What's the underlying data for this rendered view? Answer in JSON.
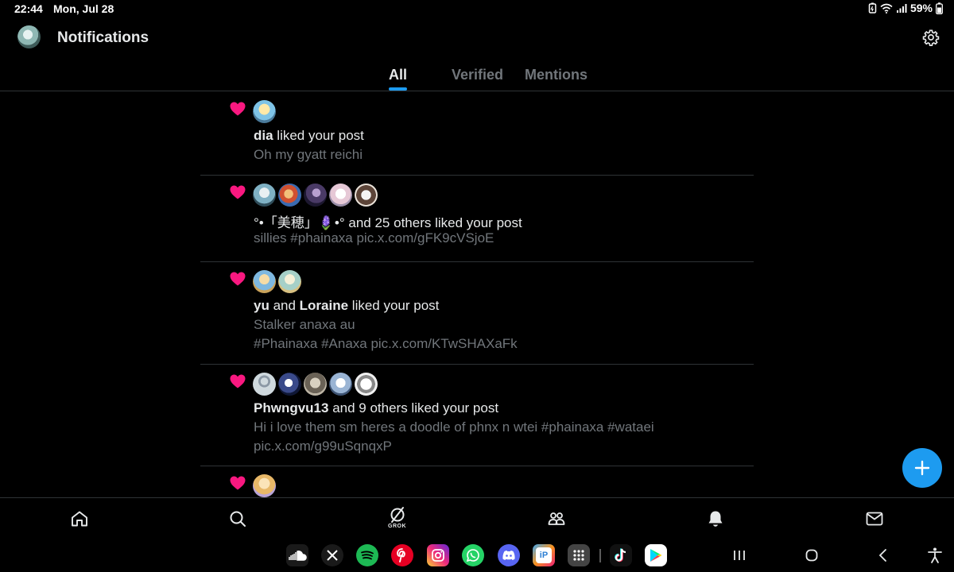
{
  "status_bar": {
    "time": "22:44",
    "date": "Mon, Jul 28",
    "battery": "59%",
    "icons": [
      "battery-saver-icon",
      "wifi-icon",
      "signal-icon",
      "battery-icon"
    ]
  },
  "header": {
    "title": "Notifications",
    "settings_icon": "gear-icon"
  },
  "tabs": [
    {
      "label": "All",
      "active": true
    },
    {
      "label": "Verified",
      "active": false
    },
    {
      "label": "Mentions",
      "active": false
    }
  ],
  "colors": {
    "accent": "#1d9bf0",
    "like": "#f91880",
    "muted_text": "#71767b",
    "primary_text": "#e7e9ea",
    "divider": "#2f3336"
  },
  "notifications": [
    {
      "type": "like",
      "actor_bold": "dia",
      "action": " liked your post",
      "preview_lines": [
        "Oh my gyatt reichi"
      ]
    },
    {
      "type": "like",
      "actor_text": "°•「美穂」🪻•°",
      "action": " and 25 others liked your post",
      "preview_lines": [
        "sillies #phainaxa pic.x.com/gFK9cVSjoE"
      ]
    },
    {
      "type": "like",
      "actor_bold": "yu",
      "connector": " and ",
      "actor2_bold": "Loraine",
      "action": " liked your post",
      "preview_lines": [
        "Stalker anaxa au",
        "#Phainaxa #Anaxa pic.x.com/KTwSHAXaFk"
      ]
    },
    {
      "type": "like",
      "actor_bold": "Phwngvu13",
      "action": " and 9 others liked your post",
      "preview_lines": [
        "Hi i love them sm heres a doodle of phnx n wtei #phainaxa #wataei",
        "pic.x.com/g99uSqnqxP"
      ]
    },
    {
      "type": "like",
      "actor_bold": "",
      "action": "",
      "preview_lines": []
    }
  ],
  "fab": {
    "icon": "plus-icon"
  },
  "bottom_nav": {
    "items": [
      "home-icon",
      "search-icon",
      "grok-icon",
      "communities-icon",
      "notifications-icon",
      "messages-icon"
    ],
    "grok_label": "GROK"
  },
  "dock": {
    "apps": [
      "SoundCloud",
      "X",
      "Spotify",
      "Pinterest",
      "Instagram",
      "WhatsApp",
      "Discord",
      "ibisPaint",
      "App drawer",
      "TikTok",
      "Google Play"
    ],
    "system_nav": [
      "recents-icon",
      "home-circle-icon",
      "back-icon",
      "accessibility-icon"
    ]
  }
}
